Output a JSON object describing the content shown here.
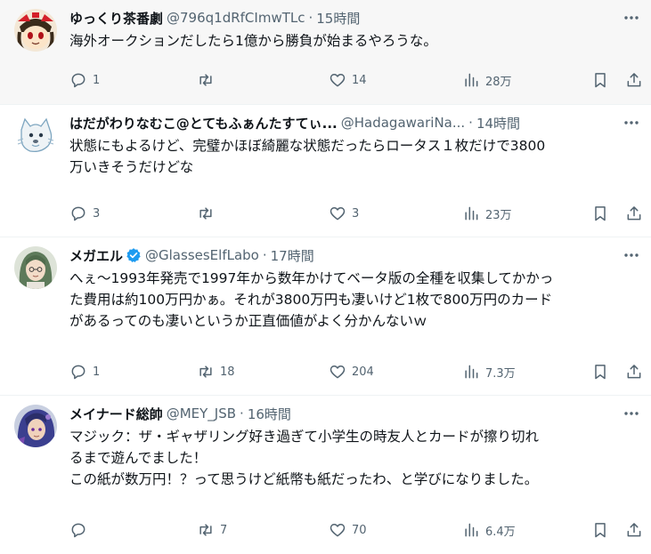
{
  "tweets": [
    {
      "name": "ゆっくり茶番劇",
      "handle": "@796q1dRfCImwTLc",
      "dot": "·",
      "time": "15時間",
      "verified": false,
      "text": "海外オークションだしたら1億から勝負が始まるやろうな。",
      "reply_count": "1",
      "retweet_count": "",
      "like_count": "14",
      "view_count": "28万",
      "highlighted": true
    },
    {
      "name": "はだがわりなむこ@とてもふぁんたすてぃ...",
      "handle": "@HadagawariNa...",
      "dot": "·",
      "time": "14時間",
      "verified": false,
      "text": "状態にもよるけど、完璧かほぼ綺麗な状態だったらロータス１枚だけで3800\n万いきそうだけどな",
      "reply_count": "3",
      "retweet_count": "",
      "like_count": "3",
      "view_count": "23万",
      "highlighted": false
    },
    {
      "name": "メガエル",
      "handle": "@GlassesElfLabo",
      "dot": "·",
      "time": "17時間",
      "verified": true,
      "text": "へぇ～1993年発売で1997年から数年かけてベータ版の全種を収集してかかっ\nた費用は約100万円かぁ。それが3800万円も凄いけど1枚で800万円のカード\nがあるってのも凄いというか正直価値がよく分かんないｗ",
      "reply_count": "1",
      "retweet_count": "18",
      "like_count": "204",
      "view_count": "7.3万",
      "highlighted": false
    },
    {
      "name": "メイナード総帥",
      "handle": "@MEY_JSB",
      "dot": "·",
      "time": "16時間",
      "verified": false,
      "text": "マジック：ザ・ギャザリング好き過ぎて小学生の時友人とカードが擦り切れ\nるまで遊んでました！\nこの紙が数万円！？って思うけど紙幣も紙だったわ、と学びになりました。",
      "reply_count": "",
      "retweet_count": "7",
      "like_count": "70",
      "view_count": "6.4万",
      "highlighted": false
    }
  ],
  "icons": {
    "reply": "speech-bubble-icon",
    "retweet": "retweet-arrows-icon",
    "like": "heart-icon",
    "views": "bar-chart-icon",
    "bookmark": "bookmark-icon",
    "share": "share-arrow-icon",
    "more": "three-dots-icon",
    "verified": "verified-badge-icon"
  },
  "colors": {
    "text": "#0f1419",
    "secondary": "#536471",
    "verified": "#1d9bf0",
    "highlight_bg": "#f7f7f7",
    "divider": "#eff3f4"
  }
}
